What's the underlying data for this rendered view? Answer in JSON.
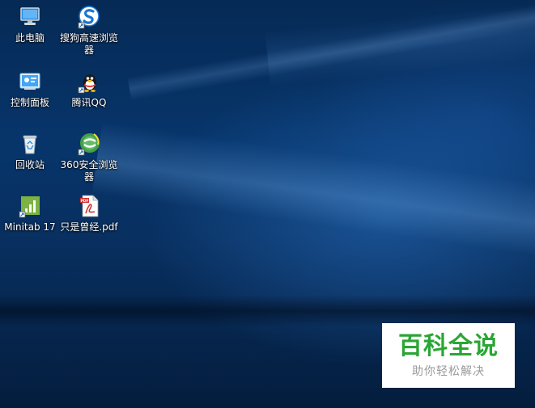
{
  "desktop": {
    "icons": [
      {
        "label": "此电脑",
        "icon": "computer-icon"
      },
      {
        "label": "搜狗高速浏览器",
        "icon": "sogou-browser-icon"
      },
      {
        "label": "控制面板",
        "icon": "control-panel-icon"
      },
      {
        "label": "腾讯QQ",
        "icon": "qq-penguin-icon"
      },
      {
        "label": "回收站",
        "icon": "recycle-bin-icon"
      },
      {
        "label": "360安全浏览器",
        "icon": "360-browser-icon"
      },
      {
        "label": "Minitab 17",
        "icon": "minitab-icon"
      },
      {
        "label": "只是曾经.pdf",
        "icon": "pdf-file-icon"
      }
    ]
  },
  "watermark": {
    "title": "百科全说",
    "subtitle": "助你轻松解决",
    "title_color": "#2aa634"
  }
}
